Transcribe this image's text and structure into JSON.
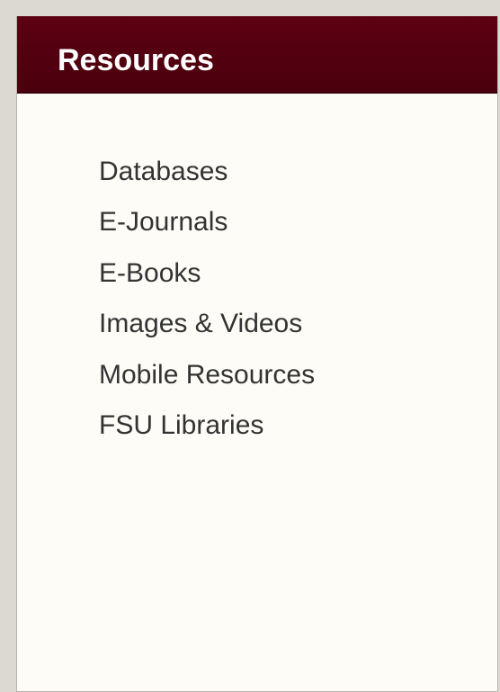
{
  "resources": {
    "title": "Resources",
    "links": [
      {
        "label": "Databases"
      },
      {
        "label": "E-Journals"
      },
      {
        "label": "E-Books"
      },
      {
        "label": "Images & Videos"
      },
      {
        "label": "Mobile Resources"
      },
      {
        "label": "FSU Libraries"
      }
    ]
  },
  "colors": {
    "header_background": "#560010",
    "header_text": "#ffffff",
    "panel_background": "#fdfcf7",
    "link_text": "#333333",
    "page_background": "#dcd8d2"
  }
}
